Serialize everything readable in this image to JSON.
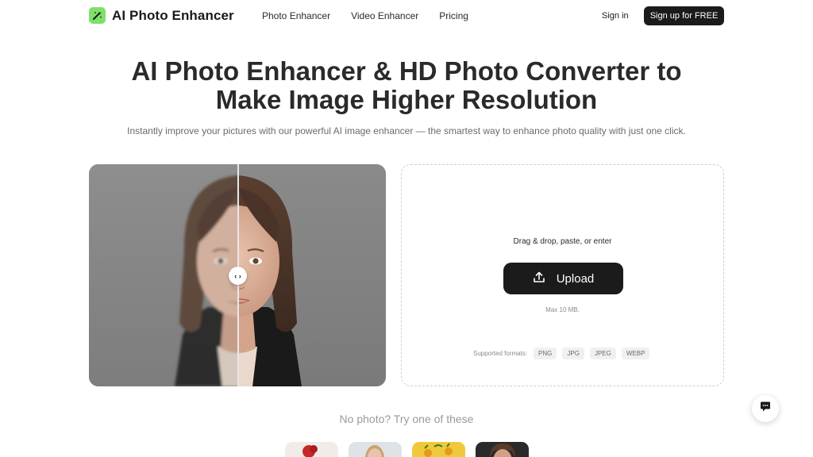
{
  "header": {
    "brand": "AI Photo Enhancer",
    "nav": [
      "Photo Enhancer",
      "Video Enhancer",
      "Pricing"
    ],
    "signin_label": "Sign in",
    "signup_label": "Sign up for FREE"
  },
  "hero": {
    "title_line1": "AI Photo Enhancer & HD Photo Converter to",
    "title_line2": "Make Image Higher Resolution",
    "subtitle": "Instantly improve your pictures with our powerful AI image enhancer — the smartest way to enhance photo quality with just one click."
  },
  "compare": {
    "handle_glyph": "‹ ›"
  },
  "upload": {
    "prompt": "Drag & drop, paste, or enter",
    "button_label": "Upload",
    "max_size": "Max 10 MB.",
    "formats_label": "Supported formats:",
    "formats": [
      "PNG",
      "JPG",
      "JPEG",
      "WEBP"
    ]
  },
  "samples": {
    "heading": "No photo? Try one of these"
  },
  "icons": {
    "logo": "magic-wand-icon",
    "upload": "upload-icon",
    "chat": "chat-icon"
  },
  "colors": {
    "brand_green": "#7ee06a",
    "button_dark": "#1b1b1b"
  }
}
